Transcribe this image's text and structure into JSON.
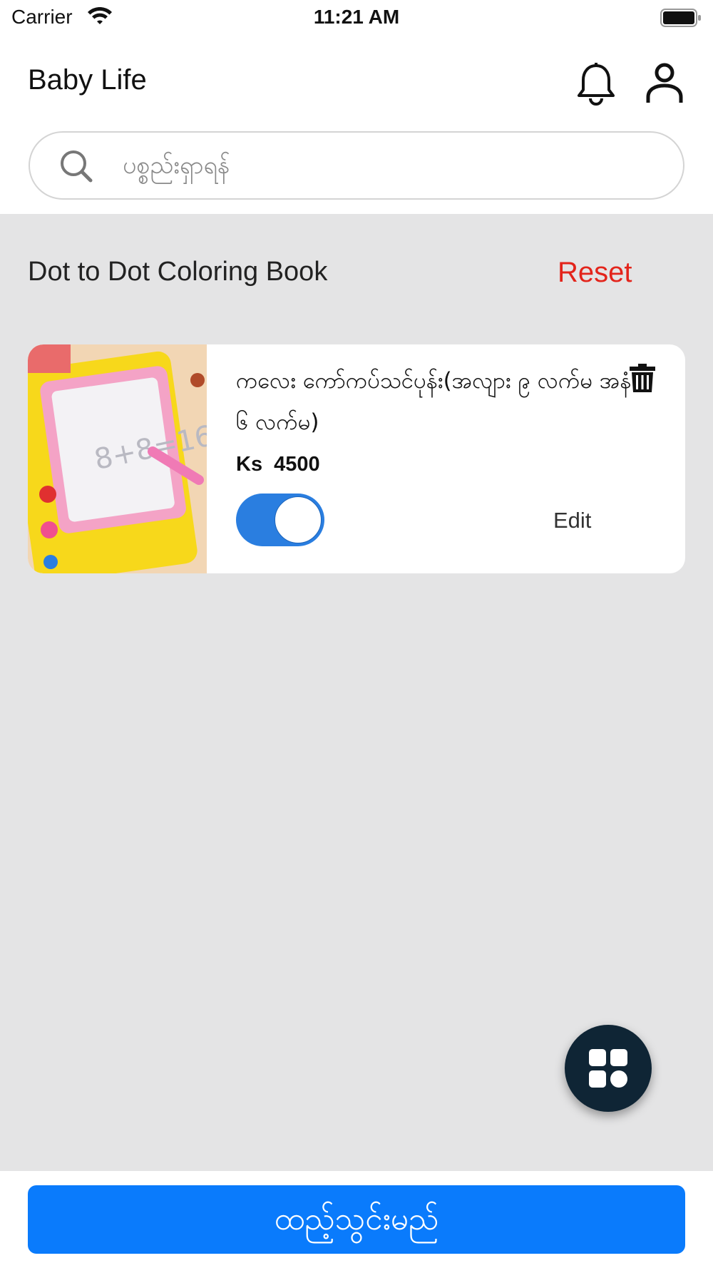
{
  "status_bar": {
    "carrier": "Carrier",
    "time": "11:21 AM"
  },
  "header": {
    "title": "Baby Life",
    "bell_icon": "bell-icon",
    "user_icon": "user-icon"
  },
  "search": {
    "placeholder": "ပစ္စည်းရှာရန်",
    "icon": "search-icon"
  },
  "category": {
    "title": "Dot to Dot Coloring Book",
    "reset_label": "Reset"
  },
  "items": [
    {
      "name": "ကလေး ကော်ကပ်သင်ပုန်း(အလျား ၉ လက်မ အနံ ၆ လက်မ)",
      "currency": "Ks",
      "price": "4500",
      "enabled": true,
      "edit_label": "Edit"
    }
  ],
  "fab": {
    "icon": "grid-icon"
  },
  "bottom": {
    "button_label": "ထည့်သွင်းမည်"
  },
  "colors": {
    "accent": "#0a7bfc",
    "toggle": "#2a7ee0",
    "reset": "#e3241b",
    "fab": "#0f2535",
    "background": "#e4e4e5"
  }
}
